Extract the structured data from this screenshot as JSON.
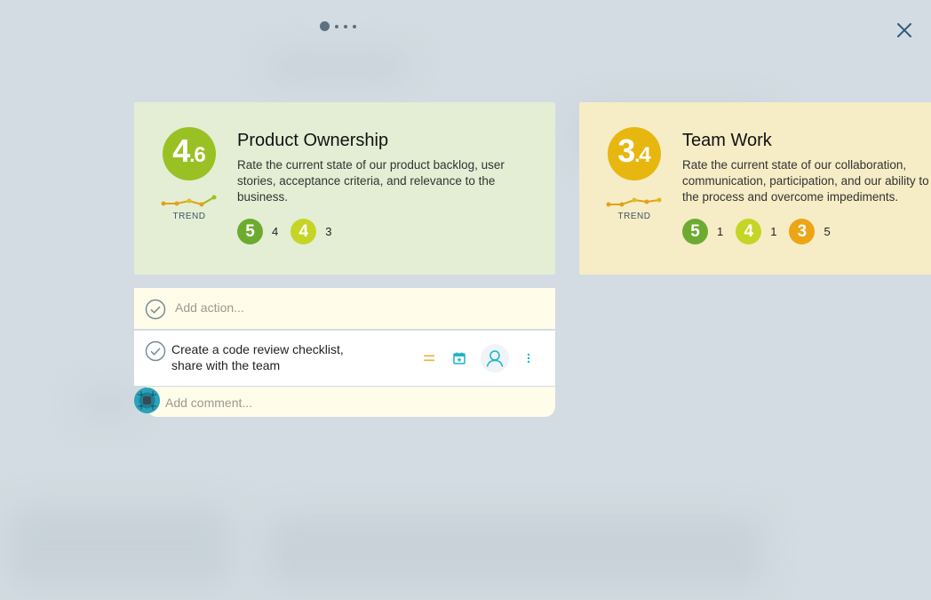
{
  "carousel": {
    "pages": 4,
    "active": 0
  },
  "cards": [
    {
      "title": "Product Ownership",
      "description": "Rate the current state of our product backlog, user stories, acceptance criteria, and relevance to the business.",
      "score_int": "4",
      "score_dot": ".",
      "score_dec": "6",
      "trend_label": "TREND",
      "votes": [
        {
          "rating": "5",
          "count": "4"
        },
        {
          "rating": "4",
          "count": "3"
        }
      ]
    },
    {
      "title": "Team Work",
      "description": "Rate the current state of our collaboration, communication, participation, and our ability to the process and overcome impediments.",
      "score_int": "3",
      "score_dot": ".",
      "score_dec": "4",
      "trend_label": "TREND",
      "votes": [
        {
          "rating": "5",
          "count": "1"
        },
        {
          "rating": "4",
          "count": "1"
        },
        {
          "rating": "3",
          "count": "5"
        }
      ]
    }
  ],
  "actions": {
    "add_placeholder": "Add action...",
    "items": [
      {
        "text": "Create a code review checklist, share with the team"
      }
    ]
  },
  "comment": {
    "placeholder": "Add comment..."
  },
  "icons": {
    "close": "close-icon",
    "check": "check-circle-icon",
    "priority": "equals-icon",
    "calendar": "calendar-add-icon",
    "assignee": "user-icon",
    "more": "more-vertical-icon"
  },
  "colors": {
    "score_green": "#9ac124",
    "score_yellow": "#e7b70f",
    "vote_5": "#6dab30",
    "vote_4": "#c5d526",
    "vote_3": "#eca515",
    "accent_teal": "#1fb3c7"
  }
}
